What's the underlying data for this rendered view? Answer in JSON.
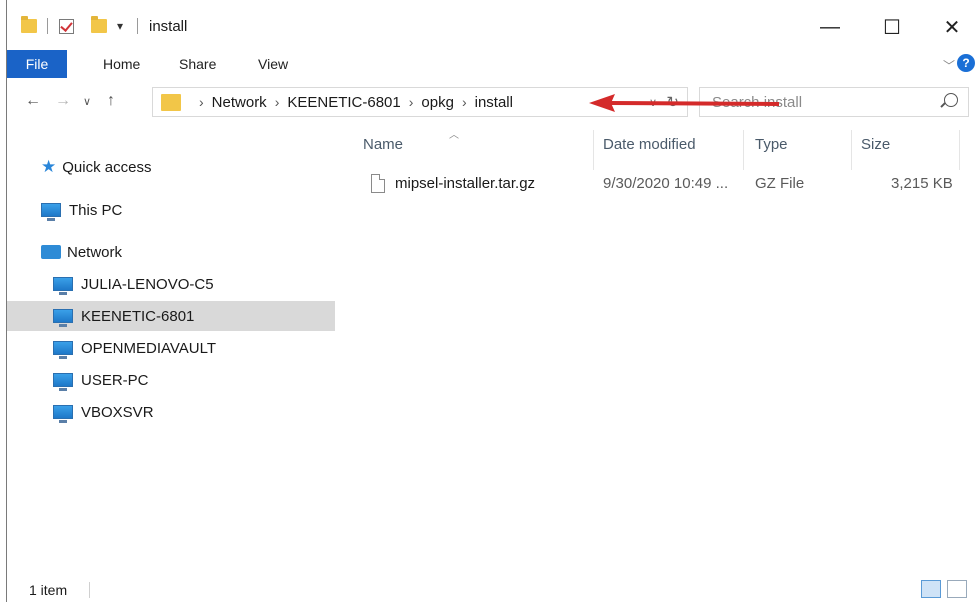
{
  "window": {
    "title": "install",
    "controls": {
      "minimize": "—",
      "maximize": "☐",
      "close": "✕"
    }
  },
  "ribbon": {
    "tabs": [
      "File",
      "Home",
      "Share",
      "View"
    ],
    "help": "?"
  },
  "nav": {
    "breadcrumbs": [
      "Network",
      "KEENETIC-6801",
      "opkg",
      "install"
    ],
    "search_placeholder": "Search install"
  },
  "sidebar": {
    "items": [
      {
        "label": "Quick access",
        "icon": "star-icon"
      },
      {
        "label": "This PC",
        "icon": "computer-icon"
      },
      {
        "label": "Network",
        "icon": "network-icon"
      },
      {
        "label": "JULIA-LENOVO-C5",
        "icon": "computer-icon"
      },
      {
        "label": "KEENETIC-6801",
        "icon": "computer-icon",
        "selected": true
      },
      {
        "label": "OPENMEDIAVAULT",
        "icon": "computer-icon"
      },
      {
        "label": "USER-PC",
        "icon": "computer-icon"
      },
      {
        "label": "VBOXSVR",
        "icon": "computer-icon"
      }
    ]
  },
  "columns": [
    "Name",
    "Date modified",
    "Type",
    "Size"
  ],
  "files": [
    {
      "name": "mipsel-installer.tar.gz",
      "date": "9/30/2020 10:49 ...",
      "type": "GZ File",
      "size": "3,215 KB"
    }
  ],
  "status": {
    "count": "1 item"
  },
  "annotation": {
    "arrow_color": "#d42a2a"
  }
}
